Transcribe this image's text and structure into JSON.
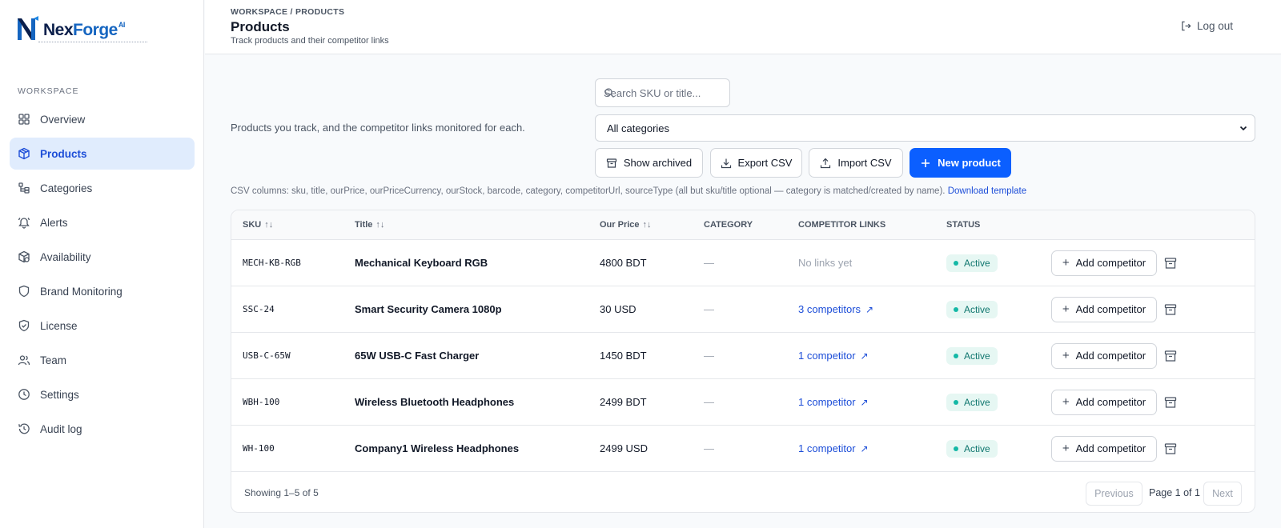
{
  "app": {
    "logo_nex": "Nex",
    "logo_forge": "Forge",
    "logo_ai": "AI"
  },
  "sidebar": {
    "heading": "WORKSPACE",
    "items": [
      {
        "label": "Overview",
        "icon": "grid-icon"
      },
      {
        "label": "Products",
        "icon": "package-icon"
      },
      {
        "label": "Categories",
        "icon": "categories-icon"
      },
      {
        "label": "Alerts",
        "icon": "bell-icon"
      },
      {
        "label": "Availability",
        "icon": "box-icon"
      },
      {
        "label": "Brand Monitoring",
        "icon": "shield-icon"
      },
      {
        "label": "License",
        "icon": "shield-check-icon"
      },
      {
        "label": "Team",
        "icon": "users-icon"
      },
      {
        "label": "Settings",
        "icon": "clock-icon"
      },
      {
        "label": "Audit log",
        "icon": "history-icon"
      }
    ],
    "active_index": 1
  },
  "header": {
    "breadcrumb": "WORKSPACE / PRODUCTS",
    "title": "Products",
    "subtitle": "Track products and their competitor links",
    "logout_label": "Log out"
  },
  "toolbar": {
    "intro": "Products you track, and the competitor links monitored for each.",
    "search_placeholder": "Search SKU or title...",
    "category_select": "All categories",
    "show_archived": "Show archived",
    "export_csv": "Export CSV",
    "import_csv": "Import CSV",
    "new_product": "New product",
    "csv_note": "CSV columns: sku, title, ourPrice, ourPriceCurrency, ourStock, barcode, category, competitorUrl, sourceType (all but sku/title optional — category is matched/created by name).",
    "download_template": "Download template"
  },
  "table": {
    "columns": {
      "sku": "SKU",
      "title": "Title",
      "price": "Our Price",
      "category": "CATEGORY",
      "links": "COMPETITOR LINKS",
      "status": "STATUS"
    },
    "sort_glyph": "↑↓",
    "add_competitor_label": "Add competitor",
    "rows": [
      {
        "sku": "MECH-KB-RGB",
        "title": "Mechanical Keyboard RGB",
        "price": "4800 BDT",
        "category": "—",
        "links": "No links yet",
        "has_links": false,
        "status": "Active"
      },
      {
        "sku": "SSC-24",
        "title": "Smart Security Camera 1080p",
        "price": "30 USD",
        "category": "—",
        "links": "3 competitors",
        "has_links": true,
        "status": "Active"
      },
      {
        "sku": "USB-C-65W",
        "title": "65W USB-C Fast Charger",
        "price": "1450 BDT",
        "category": "—",
        "links": "1 competitor",
        "has_links": true,
        "status": "Active"
      },
      {
        "sku": "WBH-100",
        "title": "Wireless Bluetooth Headphones",
        "price": "2499 BDT",
        "category": "—",
        "links": "1 competitor",
        "has_links": true,
        "status": "Active"
      },
      {
        "sku": "WH-100",
        "title": "Company1 Wireless Headphones",
        "price": "2499 USD",
        "category": "—",
        "links": "1 competitor",
        "has_links": true,
        "status": "Active"
      }
    ]
  },
  "pagination": {
    "showing": "Showing 1–5 of 5",
    "previous": "Previous",
    "page_text": "Page 1 of 1",
    "next": "Next"
  },
  "colors": {
    "accent": "#0b5fff",
    "active_nav_bg": "#e0ecfd",
    "status_green": "#14b8a6",
    "link_blue": "#1d4ed8"
  }
}
